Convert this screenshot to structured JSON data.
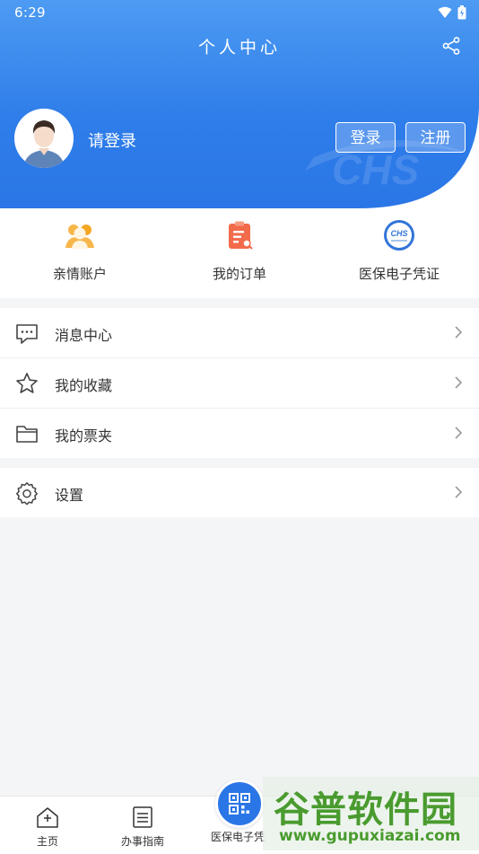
{
  "status_bar": {
    "time": "6:29"
  },
  "header": {
    "title": "个人中心",
    "login_prompt": "请登录",
    "login_button": "登录",
    "register_button": "注册",
    "watermark": "CHS"
  },
  "quick_actions": [
    {
      "label": "亲情账户",
      "icon": "family-account-icon"
    },
    {
      "label": "我的订单",
      "icon": "order-clipboard-icon"
    },
    {
      "label": "医保电子凭证",
      "icon": "chs-badge-icon"
    }
  ],
  "menu_group_1": [
    {
      "label": "消息中心",
      "icon": "message-icon"
    },
    {
      "label": "我的收藏",
      "icon": "star-icon"
    },
    {
      "label": "我的票夹",
      "icon": "folder-icon"
    }
  ],
  "menu_group_2": [
    {
      "label": "设置",
      "icon": "gear-icon"
    }
  ],
  "tab_bar": [
    {
      "label": "主页",
      "icon": "home-icon"
    },
    {
      "label": "办事指南",
      "icon": "guide-icon"
    },
    {
      "label": "医保电子凭",
      "icon": "qr-code-icon"
    }
  ],
  "overlay_watermark": {
    "text": "谷普软件园",
    "url": "www.gupuxiazai.com"
  },
  "colors": {
    "primary": "#2a76e6",
    "header_light": "#4d9bf2",
    "text": "#333333",
    "background": "#f4f5f7",
    "watermark_green": "#4a9b2f"
  }
}
